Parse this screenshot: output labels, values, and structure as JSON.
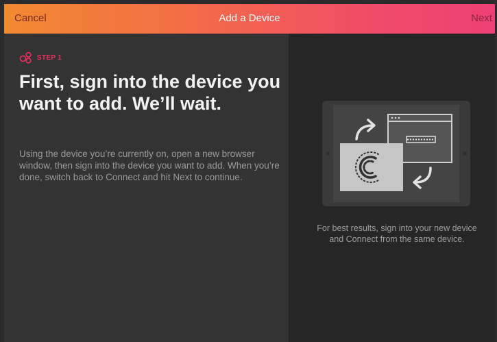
{
  "header": {
    "cancel_label": "Cancel",
    "title": "Add a Device",
    "next_label": "Next"
  },
  "step": {
    "label": "STEP 1",
    "icon": "step-icon"
  },
  "main": {
    "headline": "First, sign into the device you want to add. We’ll wait.",
    "body": "Using the device you’re currently on, open a new browser window, then sign into the device you want to add. When you’re done, switch back to Connect and hit Next to continue."
  },
  "side": {
    "illustration": "device-sync-illustration",
    "caption": "For best results, sign into your new device and Connect from the same device."
  },
  "colors": {
    "header_start": "#f28a31",
    "header_end": "#ee3f73",
    "accent": "#ee2e60",
    "left_panel": "#333333",
    "right_panel": "#262626"
  }
}
